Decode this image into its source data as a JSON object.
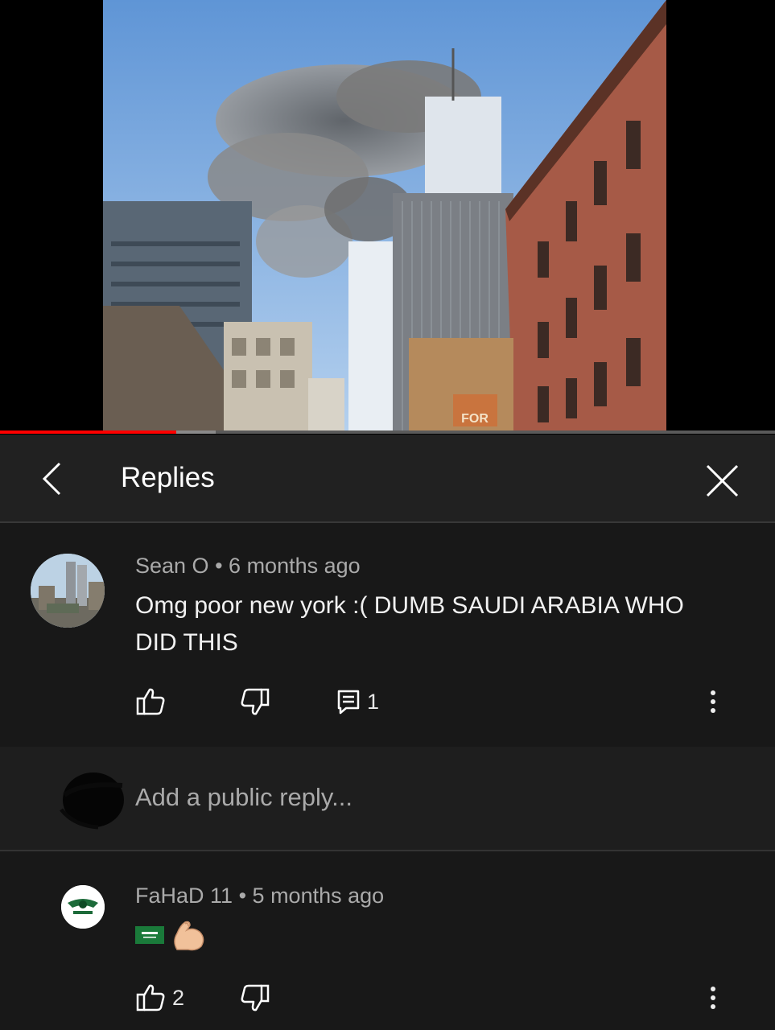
{
  "video": {
    "progress": 0.227,
    "buffered": 0.278,
    "sign_text": "FOR"
  },
  "header": {
    "title": "Replies",
    "back_icon": "chevron-left-icon",
    "close_icon": "close-icon"
  },
  "comment": {
    "author": "Sean O",
    "separator": "•",
    "age": "6 months ago",
    "text": "Omg poor new york :( DUMB SAUDI ARABIA WHO DID THIS",
    "reply_count": "1",
    "like_icon": "thumbs-up-icon",
    "dislike_icon": "thumbs-down-icon",
    "reply_icon": "comment-icon"
  },
  "reply_box": {
    "placeholder": "Add a public reply..."
  },
  "reply": {
    "author": "FaHaD 11",
    "separator": "•",
    "age": "5 months ago",
    "emoji": [
      "saudi-flag",
      "flexed-biceps"
    ],
    "like_count": "2"
  }
}
